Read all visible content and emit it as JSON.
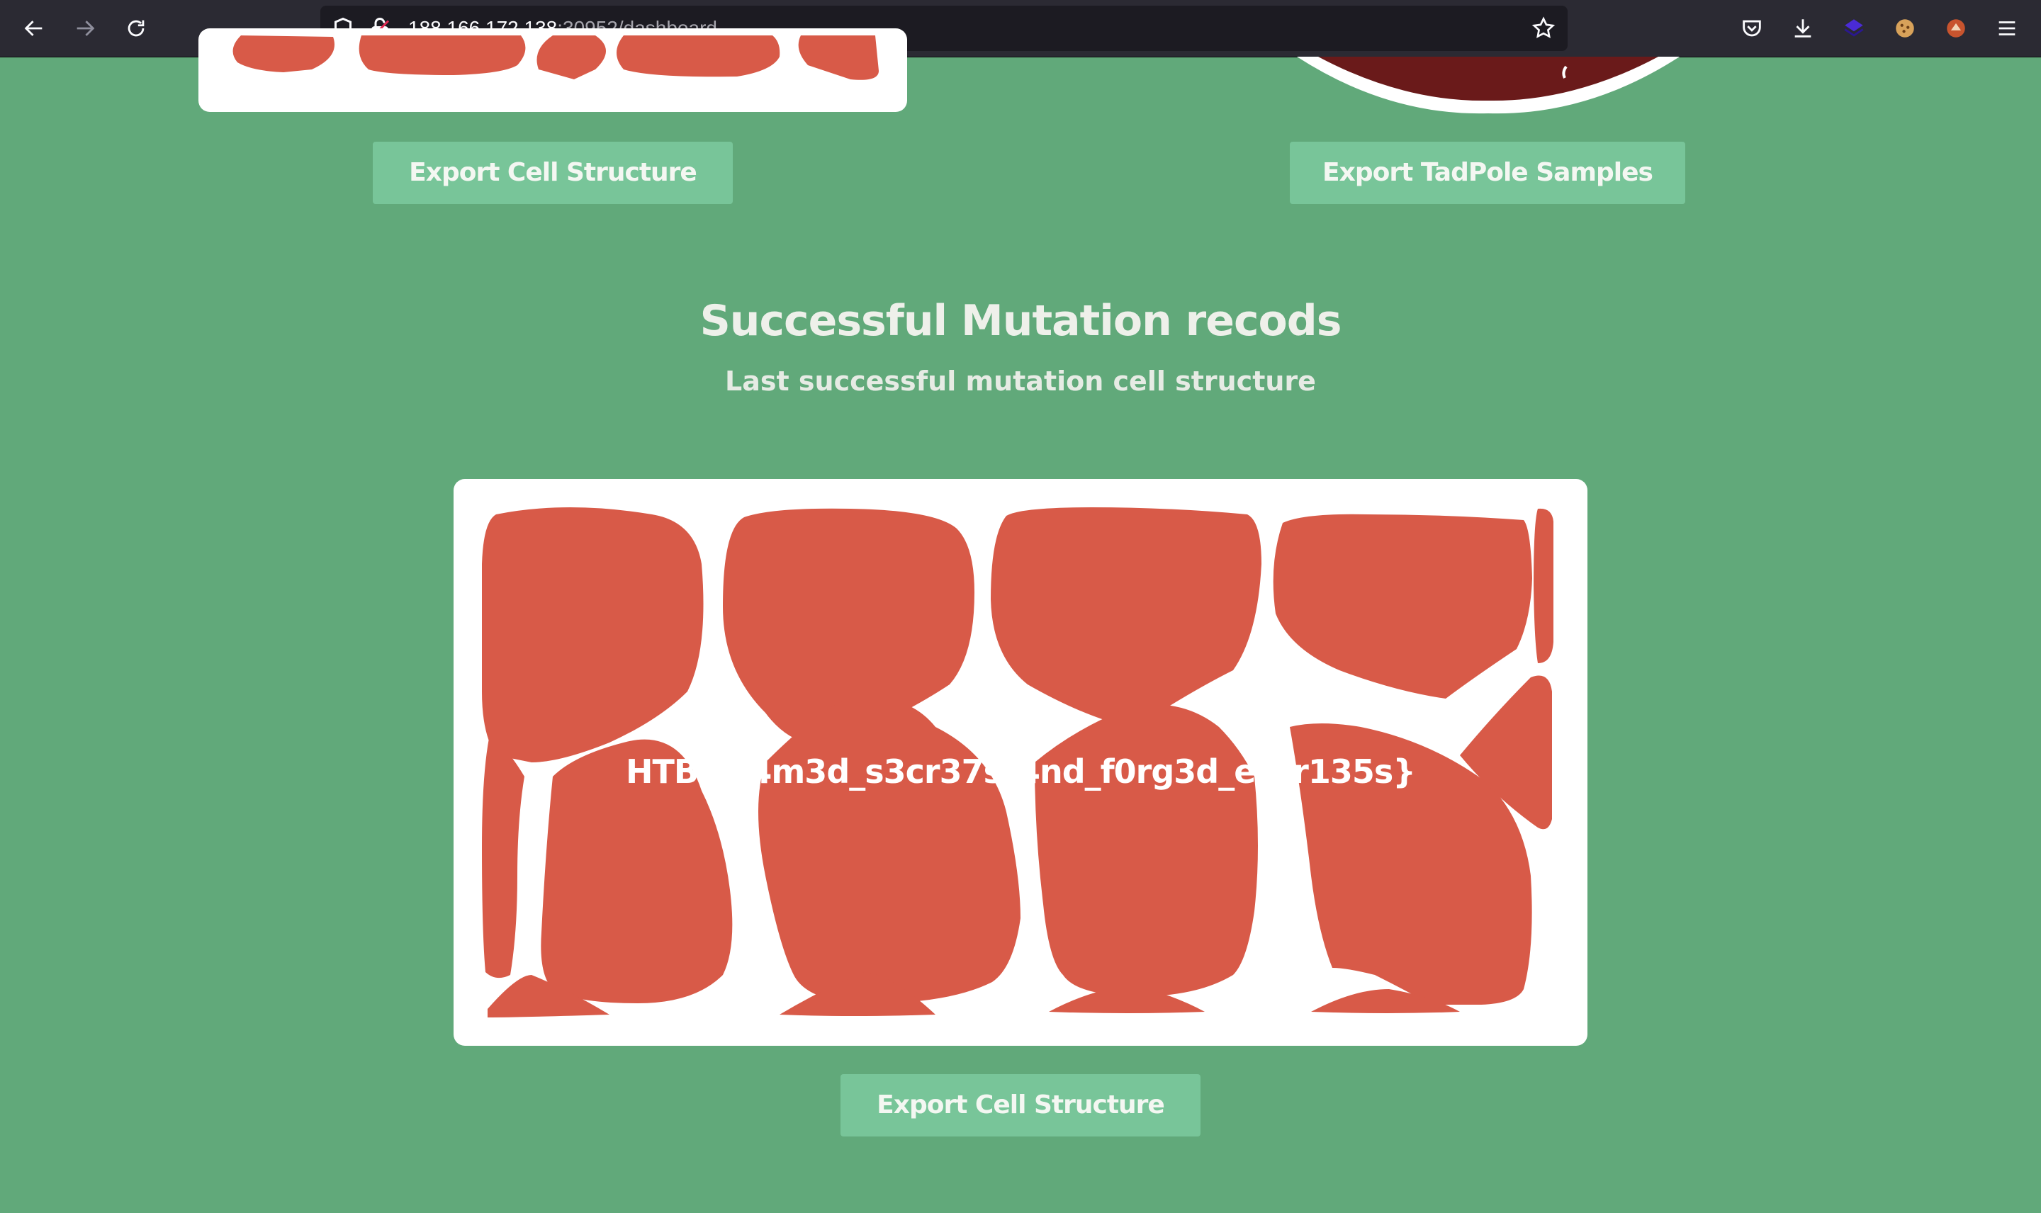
{
  "browser": {
    "url_host": "188.166.172.138",
    "url_path": ":30952/dashboard",
    "icons": [
      "back-icon",
      "forward-icon",
      "reload-icon",
      "shield-icon",
      "insecure-lock-icon",
      "bookmark-star-icon",
      "pocket-icon",
      "download-icon",
      "extension-icon",
      "cookie-icon",
      "extension-icon",
      "menu-icon"
    ]
  },
  "top_section": {
    "left_button": "Export Cell Structure",
    "right_button": "Export TadPole Samples"
  },
  "mutation_section": {
    "title": "Successful Mutation recods",
    "subtitle": "Last successful mutation cell structure",
    "flag": "HTB{fr4m3d_s3cr37s_4nd_f0rg3d_entr135s}",
    "export_button": "Export Cell Structure"
  },
  "colors": {
    "page_background": "#61a97a",
    "button_background": "#78c599",
    "cell_color": "#d85a48",
    "card_background": "#ffffff"
  }
}
